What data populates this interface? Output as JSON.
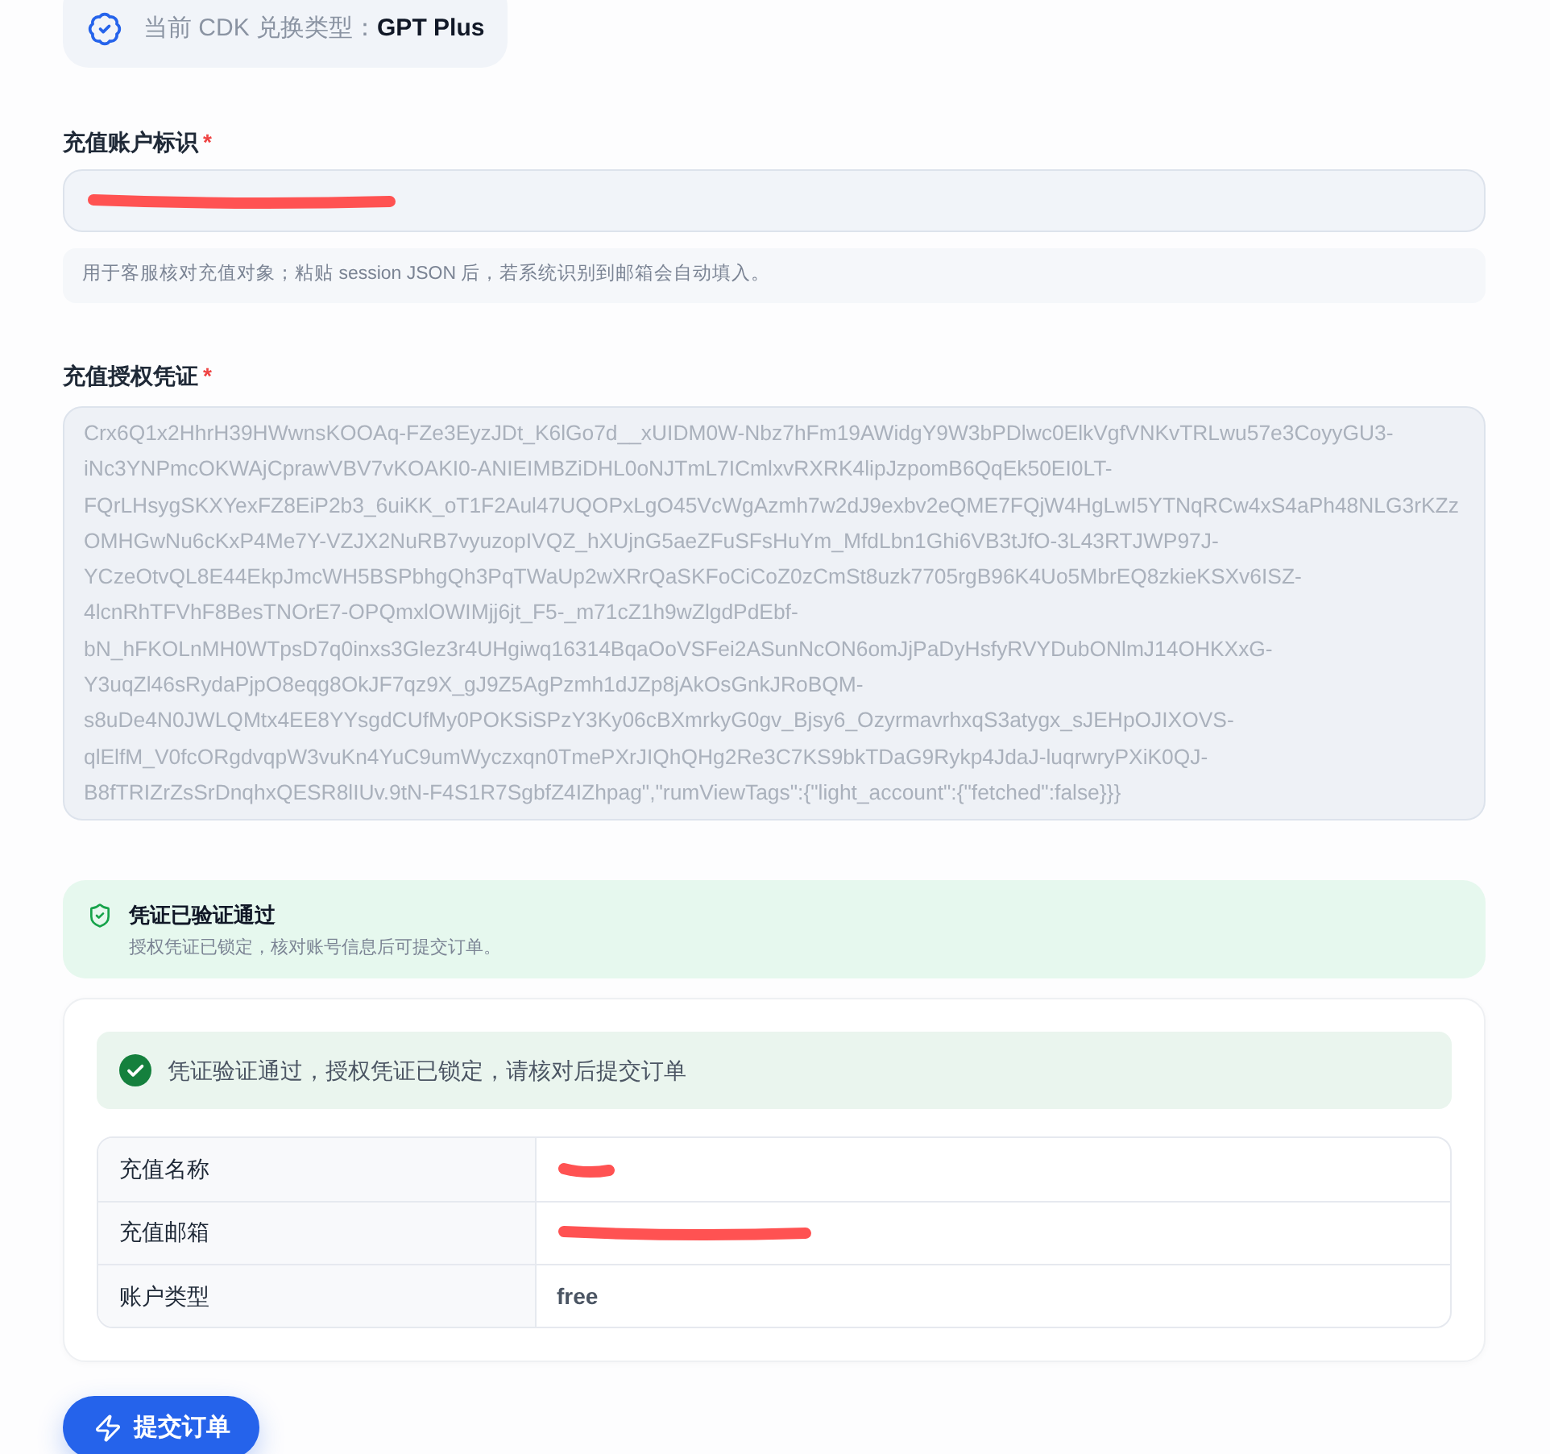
{
  "cdk_type": {
    "label": "当前 CDK 兑换类型：**GPT Plus**"
  },
  "account_field": {
    "label": "充值账户标识",
    "required_mark": "*",
    "redacted": true
  },
  "account_hint": "用于客服核对充值对象；粘贴 session JSON 后，若系统识别到邮箱会自动填入。",
  "credential_field": {
    "label": "充值授权凭证",
    "required_mark": "*",
    "disabled": true,
    "value": "Crx6Q1x2HhrH39HWwnsKOOAq-FZe3EyzJDt_K6lGo7d__xUIDM0W-Nbz7hFm19AWidgY9W3bPDlwc0ElkVgfVNKvTRLwu57e3CoyyGU3-iNc3YNPmcOKWAjCprawVBV7vKOAKI0-ANIEIMBZiDHL0oNJTmL7ICmlxvRXRK4lipJzpomB6QqEk50EI0LT-FQrLHsygSKXYexFZ8EiP2b3_6uiKK_oT1F2Aul47UQOPxLgO45VcWgAzmh7w2dJ9exbv2eQME7FQjW4HgLwI5YTNqRCw4xS4aPh48NLG3rKZzOMHGwNu6cKxP4Me7Y-VZJX2NuRB7vyuzopIVQZ_hXUjnG5aeZFuSFsHuYm_MfdLbn1Ghi6VB3tJfO-3L43RTJWP97J-YCzeOtvQL8E44EkpJmcWH5BSPbhgQh3PqTWaUp2wXRrQaSKFoCiCoZ0zCmSt8uzk7705rgB96K4Uo5MbrEQ8zkieKSXv6ISZ-4lcnRhTFVhF8BesTNOrE7-OPQmxlOWIMjj6jt_F5-_m71cZ1h9wZlgdPdEbf-bN_hFKOLnMH0WTpsD7q0inxs3Glez3r4UHgiwq16314BqaOoVSFei2ASunNcON6omJjPaDyHsfyRVYDubONlmJ14OHKXxG-Y3uqZl46sRydaPjpO8eqg8OkJF7qz9X_gJ9Z5AgPzmh1dJZp8jAkOsGnkJRoBQM-s8uDe4N0JWLQMtx4EE8YYsgdCUfMy0POKSiSPzY3Ky06cBXmrkyG0gv_Bjsy6_OzyrmavrhxqS3atygx_sJEHpOJIXOVS-qlElfM_V0fcORgdvqpW3vuKn4YuC9umWyczxqn0TmePXrJIQhQHg2Re3C7KS9bkTDaG9Rykp4JdaJ-luqrwryPXiK0QJ-B8fTRIZrZsSrDnqhxQESR8lIUv.9tN-F4S1R7SgbfZ4IZhpag\",\"rumViewTags\":{\"light_account\":{\"fetched\":false}}}"
  },
  "verified_notice": {
    "title": "凭证已验证通过",
    "text": "授权凭证已锁定，核对账号信息后可提交订单。"
  },
  "summary_card": {
    "alert": "凭证验证通过，授权凭证已锁定，请核对后提交订单",
    "rows": [
      {
        "label": "充值名称",
        "redacted": true
      },
      {
        "label": "充值邮箱",
        "redacted": true
      },
      {
        "label": "账户类型",
        "value": "free"
      }
    ]
  },
  "submit_button": {
    "label": "提交订单"
  }
}
